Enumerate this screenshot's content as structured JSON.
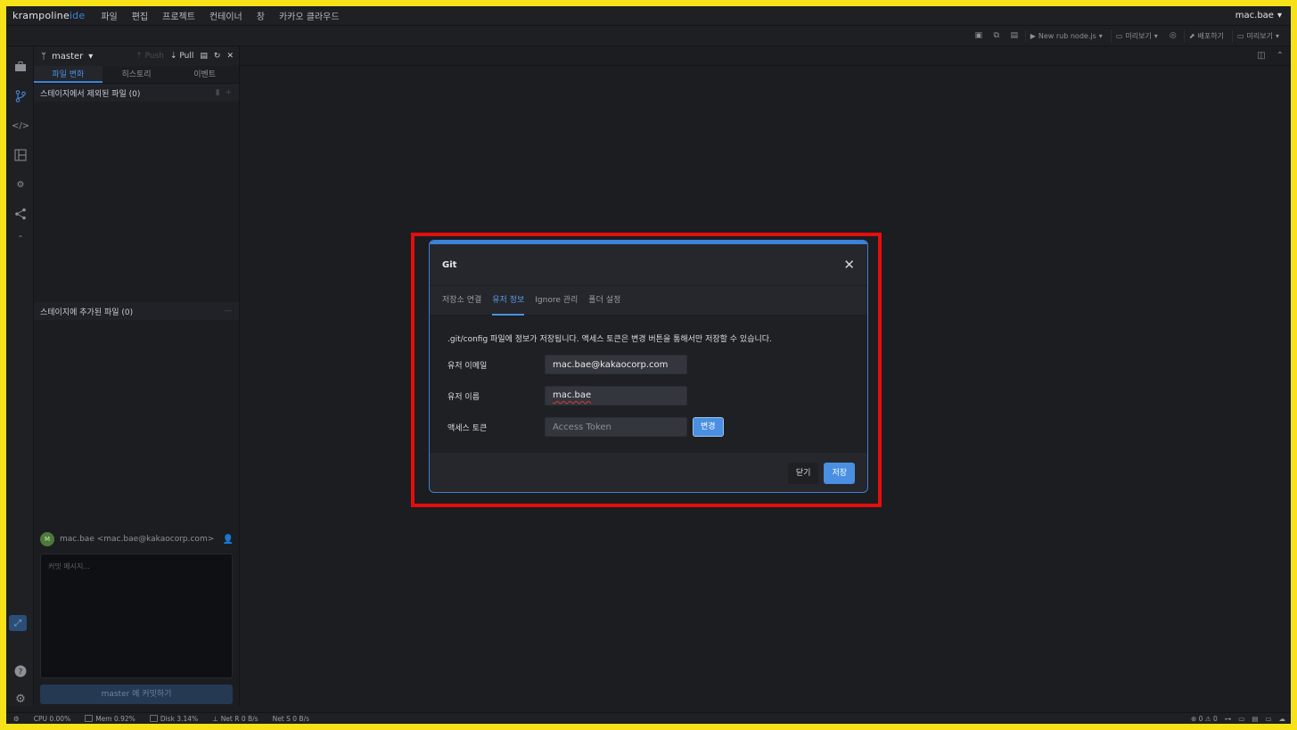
{
  "app": {
    "logo_main": "krampoline",
    "logo_accent": "ide",
    "user": "mac.bae"
  },
  "menu": [
    "파일",
    "편집",
    "프로젝트",
    "컨테이너",
    "창",
    "카카오 클라우드"
  ],
  "toolbar": {
    "run_label": "New rub node.js",
    "preview_label": "미리보기",
    "deploy_label": "배포하기",
    "preview2_label": "미리보기"
  },
  "git_panel": {
    "branch": "master",
    "push_label": "Push",
    "pull_label": "Pull",
    "tabs": [
      "파일 변화",
      "히스토리",
      "이벤트"
    ],
    "unstaged_title": "스테이지에서 제외된 파일 (0)",
    "staged_title": "스테이지에 추가된 파일 (0)",
    "avatar_letter": "M",
    "author": "mac.bae <mac.bae@kakaocorp.com>",
    "commit_placeholder": "커밋 메시지...",
    "commit_button": "master 에 커밋하기"
  },
  "status": {
    "cpu": "CPU 0.00%",
    "mem": "Mem 0.92%",
    "disk": "Disk 3.14%",
    "net_r": "Net R 0 B/s",
    "net_s": "Net S 0 B/s",
    "errors": "0",
    "warnings": "0"
  },
  "modal": {
    "title": "Git",
    "tabs": [
      "저장소 연결",
      "유저 정보",
      "Ignore 관리",
      "폴더 설정"
    ],
    "info": ".git/config 파일에 정보가 저장됩니다. 액세스 토큰은 변경 버튼을 통해서만 저장할 수 있습니다.",
    "email_label": "유저 이메일",
    "email_value": "mac.bae@kakaocorp.com",
    "name_label": "유저 이름",
    "name_value": "mac.bae",
    "token_label": "액세스 토큰",
    "token_placeholder": "Access Token",
    "change_button": "변경",
    "close_button": "닫기",
    "save_button": "저장"
  },
  "colors": {
    "accent": "#4a8fe2",
    "highlight": "#e60d0d",
    "frame": "#f7e21a"
  }
}
